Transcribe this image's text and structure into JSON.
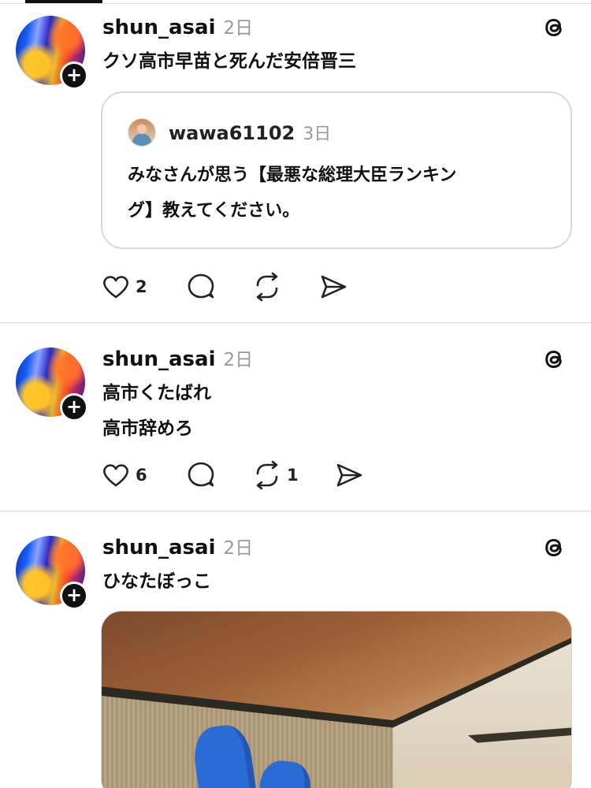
{
  "posts": [
    {
      "username": "shun_asai",
      "time": "2日",
      "text_lines": [
        "クソ高市早苗と死んだ安倍晋三"
      ],
      "quote": {
        "username": "wawa61102",
        "time": "3日",
        "text_lines": [
          "みなさんが思う【最悪な総理大臣ランキン",
          "グ】教えてください。"
        ]
      },
      "likes": "2",
      "reposts": ""
    },
    {
      "username": "shun_asai",
      "time": "2日",
      "text_lines": [
        "高市くたばれ",
        "高市辞めろ"
      ],
      "likes": "6",
      "reposts": "1"
    },
    {
      "username": "shun_asai",
      "time": "2日",
      "text_lines": [
        "ひなたぼっこ"
      ]
    }
  ],
  "icons": {
    "avatar_badge": "plus-icon",
    "corner": "threads-logo-icon",
    "like": "heart-icon",
    "reply": "comment-icon",
    "repost": "repost-icon",
    "share": "send-icon"
  },
  "colors": {
    "text": "#111111",
    "muted": "#9a9a9a",
    "divider": "#dcdcdc",
    "sock_blue": "#2b6bd6"
  }
}
